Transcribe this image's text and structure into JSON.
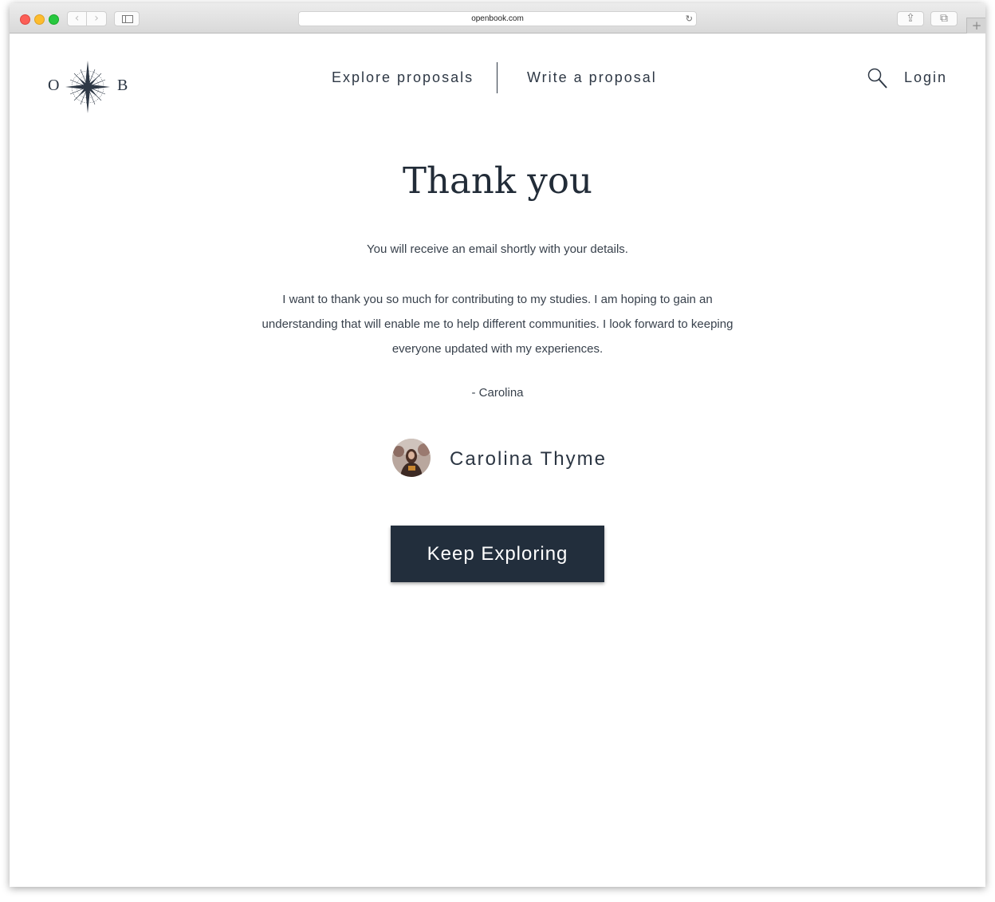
{
  "browser": {
    "url": "openbook.com",
    "back_glyph": "‹",
    "forward_glyph": "›",
    "reload_glyph": "↻",
    "share_glyph": "⇪",
    "tabs_glyph": "⧉",
    "new_tab_glyph": "+"
  },
  "header": {
    "logo_left": "O",
    "logo_right": "B",
    "nav": {
      "explore": "Explore proposals",
      "write": "Write a proposal"
    },
    "login": "Login"
  },
  "main": {
    "title": "Thank you",
    "email_note": "You will receive an email shortly with your details.",
    "message": "I want to thank you so much for contributing to my studies. I am hoping to gain an understanding that will enable me to help different communities. I look forward to keeping everyone updated with my experiences.",
    "signature": "- Carolina",
    "author_name": "Carolina Thyme",
    "cta_label": "Keep Exploring"
  },
  "colors": {
    "text_dark": "#222c38",
    "button_bg": "#222e3c",
    "button_text": "#ffffff"
  },
  "icons": [
    "compass-icon",
    "search-icon",
    "sidebar-icon",
    "share-icon",
    "tabs-icon",
    "reload-icon"
  ]
}
